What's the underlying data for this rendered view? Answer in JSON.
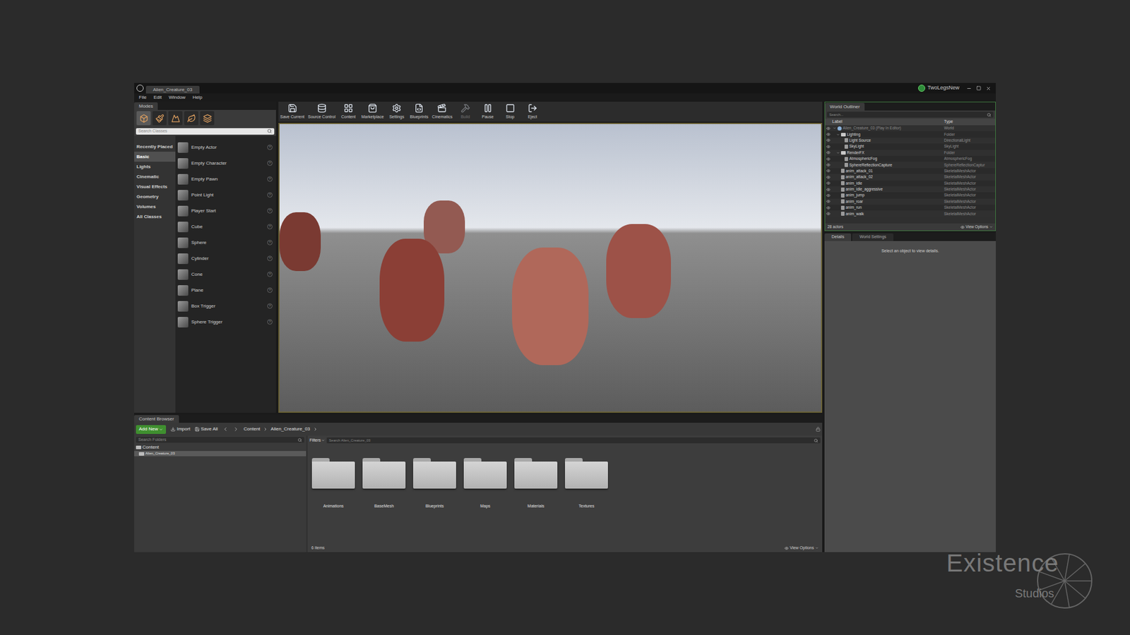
{
  "window": {
    "title": "Alien_Creature_03",
    "project": "TwoLegsNew"
  },
  "menu": [
    "File",
    "Edit",
    "Window",
    "Help"
  ],
  "modes": {
    "tab": "Modes",
    "search_placeholder": "Search Classes",
    "categories": [
      {
        "label": "Recently Placed",
        "selected": false
      },
      {
        "label": "Basic",
        "selected": true
      },
      {
        "label": "Lights",
        "selected": false
      },
      {
        "label": "Cinematic",
        "selected": false
      },
      {
        "label": "Visual Effects",
        "selected": false
      },
      {
        "label": "Geometry",
        "selected": false
      },
      {
        "label": "Volumes",
        "selected": false
      },
      {
        "label": "All Classes",
        "selected": false
      }
    ],
    "items": [
      "Empty Actor",
      "Empty Character",
      "Empty Pawn",
      "Point Light",
      "Player Start",
      "Cube",
      "Sphere",
      "Cylinder",
      "Cone",
      "Plane",
      "Box Trigger",
      "Sphere Trigger"
    ],
    "help_glyph": "?"
  },
  "toolbar": [
    {
      "label": "Save Current",
      "disabled": false
    },
    {
      "label": "Source Control",
      "disabled": false
    },
    {
      "label": "Content",
      "disabled": false
    },
    {
      "label": "Marketplace",
      "disabled": false
    },
    {
      "label": "Settings",
      "disabled": false
    },
    {
      "label": "Blueprints",
      "disabled": false
    },
    {
      "label": "Cinematics",
      "disabled": false
    },
    {
      "label": "Build",
      "disabled": true
    },
    {
      "label": "Pause",
      "disabled": false
    },
    {
      "label": "Stop",
      "disabled": false
    },
    {
      "label": "Eject",
      "disabled": false
    }
  ],
  "outliner": {
    "tab": "World Outliner",
    "search_placeholder": "Search...",
    "columns": [
      "Label",
      "Type"
    ],
    "rows": [
      {
        "label": "Alien_Creature_03 (Play In Editor)",
        "type": "World",
        "kind": "world",
        "depth": 0,
        "expanded": true
      },
      {
        "label": "Lighting",
        "type": "Folder",
        "kind": "folder",
        "depth": 1,
        "expanded": true
      },
      {
        "label": "Light Source",
        "type": "DirectionalLight",
        "kind": "actor",
        "depth": 2,
        "expanded": false
      },
      {
        "label": "SkyLight",
        "type": "SkyLight",
        "kind": "actor",
        "depth": 2,
        "expanded": false
      },
      {
        "label": "RenderFX",
        "type": "Folder",
        "kind": "folder",
        "depth": 1,
        "expanded": true
      },
      {
        "label": "AtmosphericFog",
        "type": "AtmosphericFog",
        "kind": "actor",
        "depth": 2,
        "expanded": false
      },
      {
        "label": "SphereReflectionCapture",
        "type": "SphereReflectionCaptur",
        "kind": "actor",
        "depth": 2,
        "expanded": false
      },
      {
        "label": "anim_attack_01",
        "type": "SkeletalMeshActor",
        "kind": "actor",
        "depth": 1,
        "expanded": false
      },
      {
        "label": "anim_attack_02",
        "type": "SkeletalMeshActor",
        "kind": "actor",
        "depth": 1,
        "expanded": false
      },
      {
        "label": "anim_idle",
        "type": "SkeletalMeshActor",
        "kind": "actor",
        "depth": 1,
        "expanded": false
      },
      {
        "label": "anim_idle_aggressive",
        "type": "SkeletalMeshActor",
        "kind": "actor",
        "depth": 1,
        "expanded": false
      },
      {
        "label": "anim_jump",
        "type": "SkeletalMeshActor",
        "kind": "actor",
        "depth": 1,
        "expanded": false
      },
      {
        "label": "anim_roar",
        "type": "SkeletalMeshActor",
        "kind": "actor",
        "depth": 1,
        "expanded": false
      },
      {
        "label": "anim_run",
        "type": "SkeletalMeshActor",
        "kind": "actor",
        "depth": 1,
        "expanded": false
      },
      {
        "label": "anim_walk",
        "type": "SkeletalMeshActor",
        "kind": "actor",
        "depth": 1,
        "expanded": false
      }
    ],
    "count": "28 actors",
    "view_options": "View Options"
  },
  "details": {
    "tabs": [
      {
        "label": "Details",
        "selected": true
      },
      {
        "label": "World Settings",
        "selected": false
      }
    ],
    "empty": "Select an object to view details."
  },
  "content_browser": {
    "tab": "Content Browser",
    "add_new": "Add New",
    "import": "Import",
    "save_all": "Save All",
    "path": [
      "Content",
      "Alien_Creature_03"
    ],
    "folder_search": "Search Folders",
    "tree": [
      {
        "label": "Content",
        "depth": 0,
        "selected": false
      },
      {
        "label": "Alien_Creature_03",
        "depth": 1,
        "selected": true
      }
    ],
    "filters": "Filters",
    "search_placeholder": "Search Alien_Creature_03",
    "folders": [
      "Animations",
      "BaseMesh",
      "Blueprints",
      "Maps",
      "Materials",
      "Textures"
    ],
    "count": "6 items",
    "view_options": "View Options"
  },
  "watermark": {
    "line1": "Existence",
    "line2": "Studios"
  }
}
